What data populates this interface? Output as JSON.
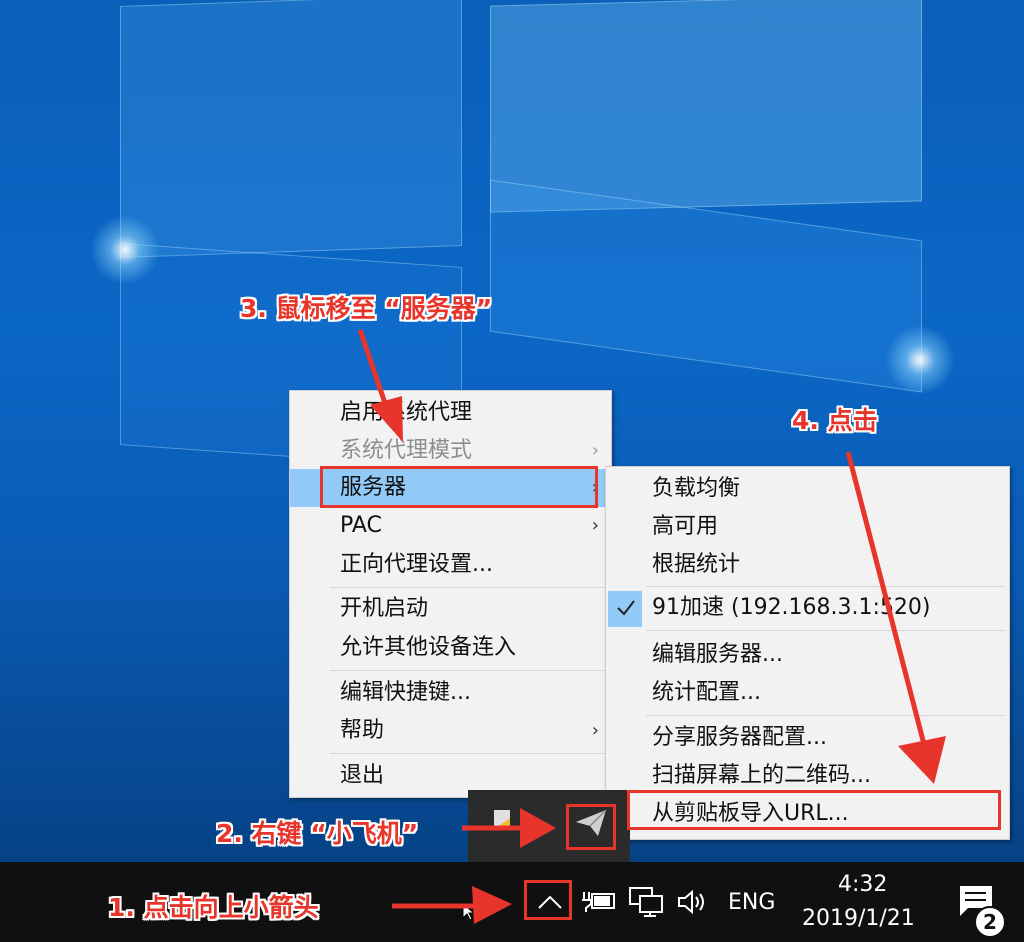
{
  "menu": {
    "items": [
      {
        "label": "启用系统代理",
        "arrow": false,
        "disabled": false
      },
      {
        "label": "系统代理模式",
        "arrow": true,
        "disabled": true
      },
      {
        "label": "服务器",
        "arrow": true,
        "disabled": false,
        "highlighted": true
      },
      {
        "label": "PAC",
        "arrow": true,
        "disabled": false
      },
      {
        "label": "正向代理设置...",
        "arrow": false,
        "disabled": false
      },
      {
        "label": "开机启动",
        "arrow": false,
        "disabled": false
      },
      {
        "label": "允许其他设备连入",
        "arrow": false,
        "disabled": false
      },
      {
        "label": "编辑快捷键...",
        "arrow": false,
        "disabled": false
      },
      {
        "label": "帮助",
        "arrow": true,
        "disabled": false
      },
      {
        "label": "退出",
        "arrow": false,
        "disabled": false
      }
    ],
    "chevron": "›"
  },
  "submenu": {
    "items": [
      {
        "label": "负载均衡"
      },
      {
        "label": "高可用"
      },
      {
        "label": "根据统计"
      },
      {
        "label": "91加速 (192.168.3.1:520)",
        "checked": true
      },
      {
        "label": "编辑服务器..."
      },
      {
        "label": "统计配置..."
      },
      {
        "label": "分享服务器配置..."
      },
      {
        "label": "扫描屏幕上的二维码..."
      },
      {
        "label": "从剪贴板导入URL..."
      }
    ]
  },
  "taskbar": {
    "language": "ENG",
    "time": "4:32",
    "date": "2019/1/21",
    "notification_count": "2",
    "icons": [
      "chevron-up-icon",
      "power-icon",
      "network-icon",
      "volume-icon"
    ]
  },
  "annotations": {
    "step1": "1. 点击向上小箭头",
    "step2": "2. 右键 “小飞机”",
    "step3": "3. 鼠标移至 “服务器”",
    "step4": "4. 点击",
    "accent_color": "#e8352c"
  }
}
